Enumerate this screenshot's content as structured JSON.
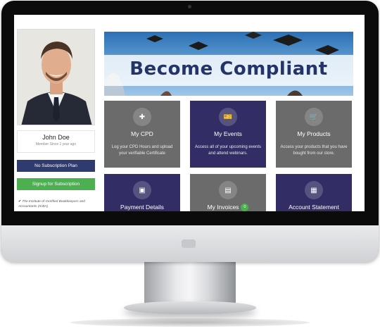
{
  "banner": {
    "title": "Become Compliant"
  },
  "profile": {
    "name": "John Doe",
    "member_since": "Member Since 1 year ago",
    "plan_button": "No Subscription Plan",
    "signup_button": "Signup for Subscription",
    "membership": "The Institute of Certified Bookkeepers and Accountants (ICBA)"
  },
  "tiles": [
    {
      "title": "My CPD",
      "desc": "Log your CPD Hours and upload your verifiable Certificate",
      "icon": "plus-icon"
    },
    {
      "title": "My Events",
      "desc": "Access all of your upcoming events and attend webinars.",
      "icon": "ticket-icon"
    },
    {
      "title": "My Products",
      "desc": "Access your products that you have bought from our store.",
      "icon": "cart-icon"
    },
    {
      "title": "Payment Details",
      "icon": "card-icon"
    },
    {
      "title": "My Invoices",
      "badge": "0",
      "icon": "invoice-icon"
    },
    {
      "title": "Account Statement",
      "icon": "statement-icon"
    }
  ],
  "colors": {
    "navy": "#322e65",
    "gray": "#6b6b6b",
    "green": "#4cb050",
    "plan": "#2f3a6e"
  }
}
